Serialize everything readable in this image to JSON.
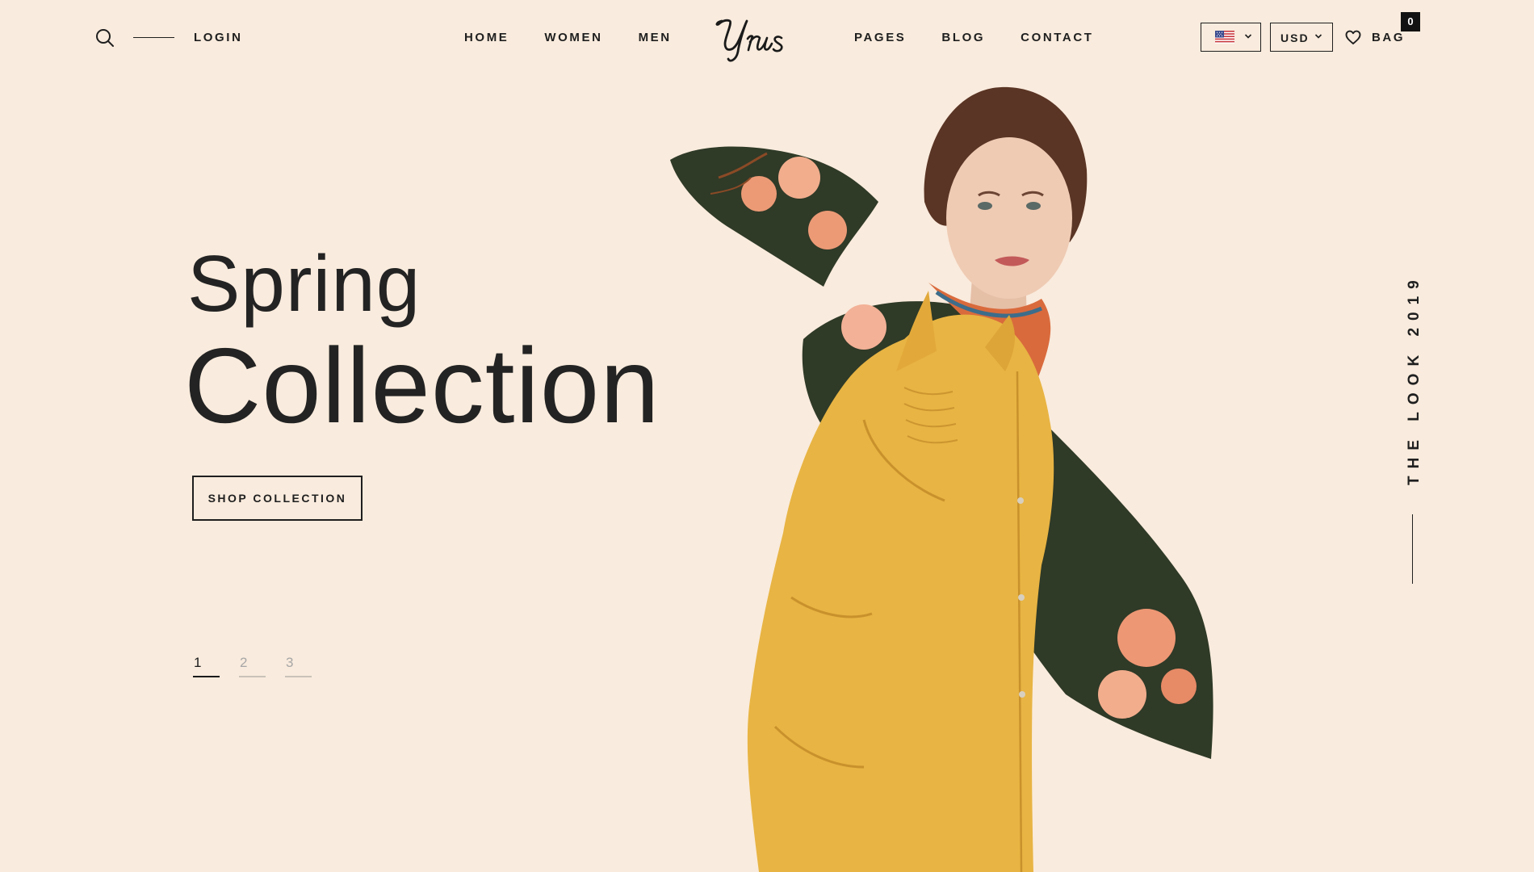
{
  "header": {
    "login_label": "LOGIN",
    "nav_left": [
      "HOME",
      "WOMEN",
      "MEN"
    ],
    "nav_right": [
      "PAGES",
      "BLOG",
      "CONTACT"
    ],
    "logo_text": "Urus",
    "language": {
      "flag": "us-flag-icon"
    },
    "currency": "USD",
    "bag_label": "BAG",
    "bag_count": "0"
  },
  "hero": {
    "title_line1": "Spring",
    "title_line2": "Collection",
    "cta_label": "SHOP COLLECTION",
    "vertical_label": "THE LOOK 2019"
  },
  "pagination": {
    "pages": [
      "1",
      "2",
      "3"
    ],
    "active_index": 0
  },
  "colors": {
    "background": "#f9ebdd",
    "text": "#1f1f1f",
    "badge_bg": "#121212",
    "shirt": "#e8b443",
    "flower": "#ec9a76",
    "leaf": "#2f3a27"
  },
  "icons": {
    "search": "search-icon",
    "heart": "heart-icon",
    "chevron": "chevron-down-icon"
  }
}
